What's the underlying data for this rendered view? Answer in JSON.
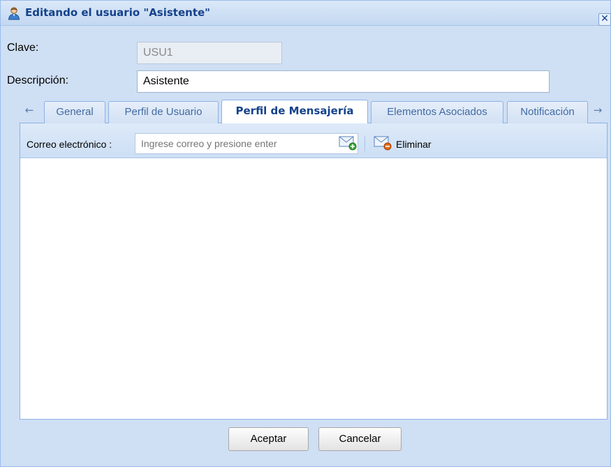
{
  "window": {
    "title": "Editando el usuario \"Asistente\"",
    "title_icon": "user-icon",
    "close_glyph": "✕"
  },
  "form": {
    "clave_label": "Clave:",
    "clave_value": "USU1",
    "descripcion_label": "Descripción:",
    "descripcion_value": "Asistente"
  },
  "tabs": {
    "scroll_left_glyph": "←",
    "scroll_right_glyph": "→",
    "items": [
      {
        "label": "General",
        "active": false
      },
      {
        "label": "Perfil de Usuario",
        "active": false
      },
      {
        "label": "Perfil de Mensajería",
        "active": true
      },
      {
        "label": "Elementos Asociados",
        "active": false
      },
      {
        "label": "Notificación",
        "active": false
      }
    ]
  },
  "toolbar": {
    "email_label": "Correo electrónico :",
    "email_placeholder": "Ingrese correo y presione enter",
    "add_icon": "mail-add-icon",
    "delete_icon": "mail-delete-icon",
    "delete_label": "Eliminar"
  },
  "buttons": {
    "accept_label": "Aceptar",
    "cancel_label": "Cancelar"
  },
  "colors": {
    "title_text": "#15428b",
    "frame_bg": "#cfdff4",
    "border": "#99bbe8"
  }
}
